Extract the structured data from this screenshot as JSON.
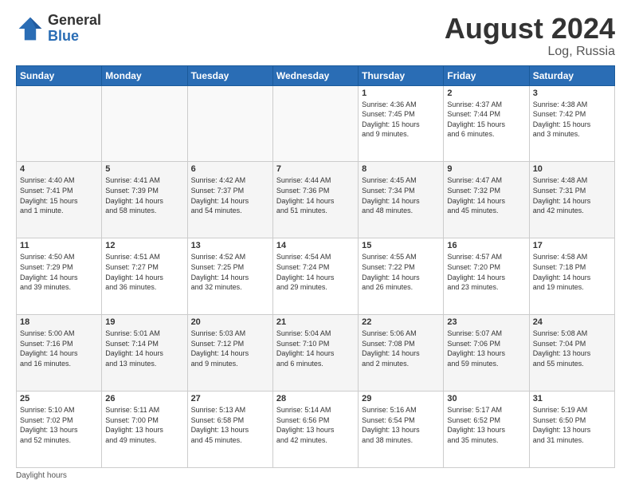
{
  "header": {
    "logo_general": "General",
    "logo_blue": "Blue",
    "month_year": "August 2024",
    "location": "Log, Russia"
  },
  "footer": {
    "note": "Daylight hours"
  },
  "weekdays": [
    "Sunday",
    "Monday",
    "Tuesday",
    "Wednesday",
    "Thursday",
    "Friday",
    "Saturday"
  ],
  "weeks": [
    [
      {
        "day": "",
        "info": ""
      },
      {
        "day": "",
        "info": ""
      },
      {
        "day": "",
        "info": ""
      },
      {
        "day": "",
        "info": ""
      },
      {
        "day": "1",
        "info": "Sunrise: 4:36 AM\nSunset: 7:45 PM\nDaylight: 15 hours\nand 9 minutes."
      },
      {
        "day": "2",
        "info": "Sunrise: 4:37 AM\nSunset: 7:44 PM\nDaylight: 15 hours\nand 6 minutes."
      },
      {
        "day": "3",
        "info": "Sunrise: 4:38 AM\nSunset: 7:42 PM\nDaylight: 15 hours\nand 3 minutes."
      }
    ],
    [
      {
        "day": "4",
        "info": "Sunrise: 4:40 AM\nSunset: 7:41 PM\nDaylight: 15 hours\nand 1 minute."
      },
      {
        "day": "5",
        "info": "Sunrise: 4:41 AM\nSunset: 7:39 PM\nDaylight: 14 hours\nand 58 minutes."
      },
      {
        "day": "6",
        "info": "Sunrise: 4:42 AM\nSunset: 7:37 PM\nDaylight: 14 hours\nand 54 minutes."
      },
      {
        "day": "7",
        "info": "Sunrise: 4:44 AM\nSunset: 7:36 PM\nDaylight: 14 hours\nand 51 minutes."
      },
      {
        "day": "8",
        "info": "Sunrise: 4:45 AM\nSunset: 7:34 PM\nDaylight: 14 hours\nand 48 minutes."
      },
      {
        "day": "9",
        "info": "Sunrise: 4:47 AM\nSunset: 7:32 PM\nDaylight: 14 hours\nand 45 minutes."
      },
      {
        "day": "10",
        "info": "Sunrise: 4:48 AM\nSunset: 7:31 PM\nDaylight: 14 hours\nand 42 minutes."
      }
    ],
    [
      {
        "day": "11",
        "info": "Sunrise: 4:50 AM\nSunset: 7:29 PM\nDaylight: 14 hours\nand 39 minutes."
      },
      {
        "day": "12",
        "info": "Sunrise: 4:51 AM\nSunset: 7:27 PM\nDaylight: 14 hours\nand 36 minutes."
      },
      {
        "day": "13",
        "info": "Sunrise: 4:52 AM\nSunset: 7:25 PM\nDaylight: 14 hours\nand 32 minutes."
      },
      {
        "day": "14",
        "info": "Sunrise: 4:54 AM\nSunset: 7:24 PM\nDaylight: 14 hours\nand 29 minutes."
      },
      {
        "day": "15",
        "info": "Sunrise: 4:55 AM\nSunset: 7:22 PM\nDaylight: 14 hours\nand 26 minutes."
      },
      {
        "day": "16",
        "info": "Sunrise: 4:57 AM\nSunset: 7:20 PM\nDaylight: 14 hours\nand 23 minutes."
      },
      {
        "day": "17",
        "info": "Sunrise: 4:58 AM\nSunset: 7:18 PM\nDaylight: 14 hours\nand 19 minutes."
      }
    ],
    [
      {
        "day": "18",
        "info": "Sunrise: 5:00 AM\nSunset: 7:16 PM\nDaylight: 14 hours\nand 16 minutes."
      },
      {
        "day": "19",
        "info": "Sunrise: 5:01 AM\nSunset: 7:14 PM\nDaylight: 14 hours\nand 13 minutes."
      },
      {
        "day": "20",
        "info": "Sunrise: 5:03 AM\nSunset: 7:12 PM\nDaylight: 14 hours\nand 9 minutes."
      },
      {
        "day": "21",
        "info": "Sunrise: 5:04 AM\nSunset: 7:10 PM\nDaylight: 14 hours\nand 6 minutes."
      },
      {
        "day": "22",
        "info": "Sunrise: 5:06 AM\nSunset: 7:08 PM\nDaylight: 14 hours\nand 2 minutes."
      },
      {
        "day": "23",
        "info": "Sunrise: 5:07 AM\nSunset: 7:06 PM\nDaylight: 13 hours\nand 59 minutes."
      },
      {
        "day": "24",
        "info": "Sunrise: 5:08 AM\nSunset: 7:04 PM\nDaylight: 13 hours\nand 55 minutes."
      }
    ],
    [
      {
        "day": "25",
        "info": "Sunrise: 5:10 AM\nSunset: 7:02 PM\nDaylight: 13 hours\nand 52 minutes."
      },
      {
        "day": "26",
        "info": "Sunrise: 5:11 AM\nSunset: 7:00 PM\nDaylight: 13 hours\nand 49 minutes."
      },
      {
        "day": "27",
        "info": "Sunrise: 5:13 AM\nSunset: 6:58 PM\nDaylight: 13 hours\nand 45 minutes."
      },
      {
        "day": "28",
        "info": "Sunrise: 5:14 AM\nSunset: 6:56 PM\nDaylight: 13 hours\nand 42 minutes."
      },
      {
        "day": "29",
        "info": "Sunrise: 5:16 AM\nSunset: 6:54 PM\nDaylight: 13 hours\nand 38 minutes."
      },
      {
        "day": "30",
        "info": "Sunrise: 5:17 AM\nSunset: 6:52 PM\nDaylight: 13 hours\nand 35 minutes."
      },
      {
        "day": "31",
        "info": "Sunrise: 5:19 AM\nSunset: 6:50 PM\nDaylight: 13 hours\nand 31 minutes."
      }
    ]
  ]
}
